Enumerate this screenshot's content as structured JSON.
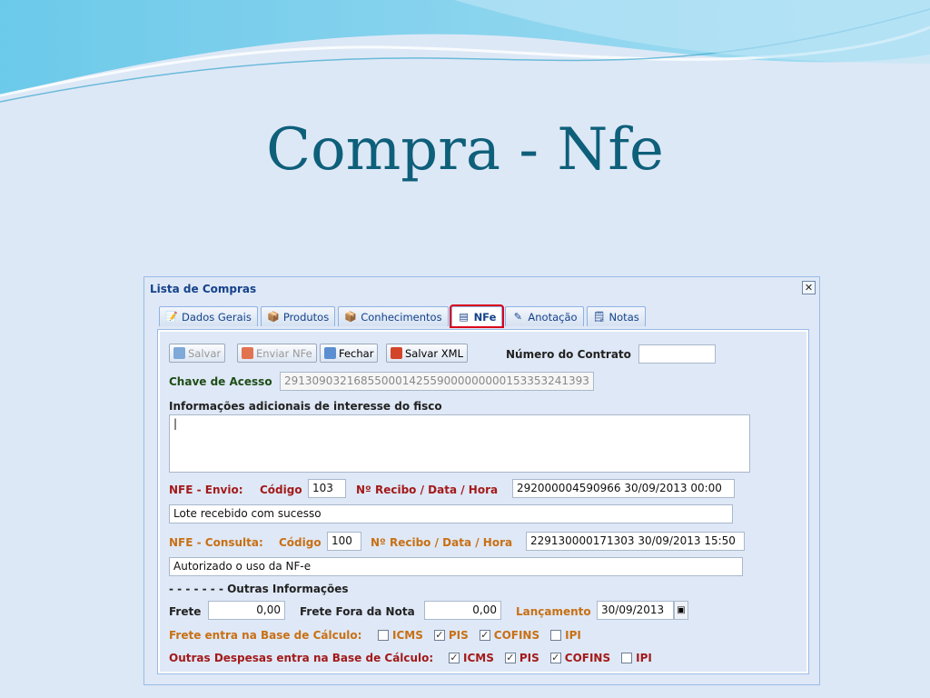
{
  "slide": {
    "title": "Compra - Nfe"
  },
  "window": {
    "title": "Lista de Compras",
    "close": "✕"
  },
  "tabs": [
    {
      "label": "Dados Gerais",
      "icon": "📝"
    },
    {
      "label": "Produtos",
      "icon": "📦"
    },
    {
      "label": "Conhecimentos",
      "icon": "📦"
    },
    {
      "label": "NFe",
      "icon": "▤"
    },
    {
      "label": "Anotação",
      "icon": "✎"
    },
    {
      "label": "Notas",
      "icon": "🗒"
    }
  ],
  "toolbar": {
    "salvar": "Salvar",
    "enviar": "Enviar NFe",
    "fechar": "Fechar",
    "salvar_xml": "Salvar XML"
  },
  "contrato": {
    "label": "Número do Contrato",
    "value": ""
  },
  "chave": {
    "label": "Chave de Acesso",
    "value": "29130903216855000142559000000000153353241393"
  },
  "info": {
    "label": "Informações adicionais de interesse do fisco",
    "value": "|"
  },
  "envio": {
    "label": "NFE - Envio:",
    "codigo_label": "Código",
    "codigo": "103",
    "recibo_label": "Nº Recibo / Data / Hora",
    "recibo": "292000004590966 30/09/2013 00:00",
    "mensagem": "Lote recebido com sucesso"
  },
  "consulta": {
    "label": "NFE - Consulta:",
    "codigo_label": "Código",
    "codigo": "100",
    "recibo_label": "Nº Recibo / Data / Hora",
    "recibo": "229130000171303 30/09/2013 15:50",
    "mensagem": "Autorizado o uso da NF-e"
  },
  "outras": {
    "header": "- - - - - - - Outras Informações"
  },
  "frete": {
    "label": "Frete",
    "value": "0,00"
  },
  "frete_fora": {
    "label": "Frete Fora da Nota",
    "value": "0,00"
  },
  "lancamento": {
    "label": "Lançamento",
    "value": "30/09/2013"
  },
  "frete_base": {
    "label": "Frete entra na Base de Cálculo:",
    "items": [
      {
        "label": "ICMS",
        "checked": false
      },
      {
        "label": "PIS",
        "checked": true
      },
      {
        "label": "COFINS",
        "checked": true
      },
      {
        "label": "IPI",
        "checked": false
      }
    ]
  },
  "despesas_base": {
    "label": "Outras Despesas entra na Base de Cálculo:",
    "items": [
      {
        "label": "ICMS",
        "checked": true
      },
      {
        "label": "PIS",
        "checked": true
      },
      {
        "label": "COFINS",
        "checked": true
      },
      {
        "label": "IPI",
        "checked": false
      }
    ]
  },
  "colors": {
    "title": "#0e5f7a",
    "red_label": "#a31a1a",
    "orange_label": "#c87014",
    "green_label": "#1e4d16",
    "active_tab_outline": "#d9001b"
  }
}
